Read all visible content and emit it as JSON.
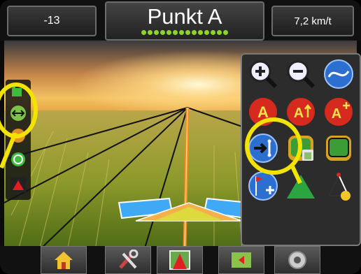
{
  "header": {
    "left_value": "-13",
    "title": "Punkt A",
    "right_value": "7,2 km/t",
    "indicator_dot_count": 14
  },
  "left_toolbar": {
    "icons": [
      "tractor-icon",
      "guideline-icon",
      "gps-icon",
      "steering-icon",
      "vehicle-icon"
    ]
  },
  "guidance_panel": {
    "buttons": [
      "zoom-in-icon",
      "zoom-out-icon",
      "curve-guideline-icon",
      "mark-a-icon",
      "mark-a-plus-icon",
      "mark-a-advance-icon",
      "nudge-guideline-icon",
      "delete-boundary-icon",
      "boundary-icon",
      "add-marker-icon",
      "area-coverage-icon",
      "pivot-guideline-icon"
    ]
  },
  "bottom_tabs": [
    "home-icon",
    "tools-icon",
    "guidance-view-icon",
    "field-view-icon",
    "camera-icon"
  ],
  "colors": {
    "accent_green": "#8fd42b",
    "highlight_yellow": "#f3e300",
    "button_red": "#d62a1f",
    "button_blue": "#2d6fd0"
  }
}
